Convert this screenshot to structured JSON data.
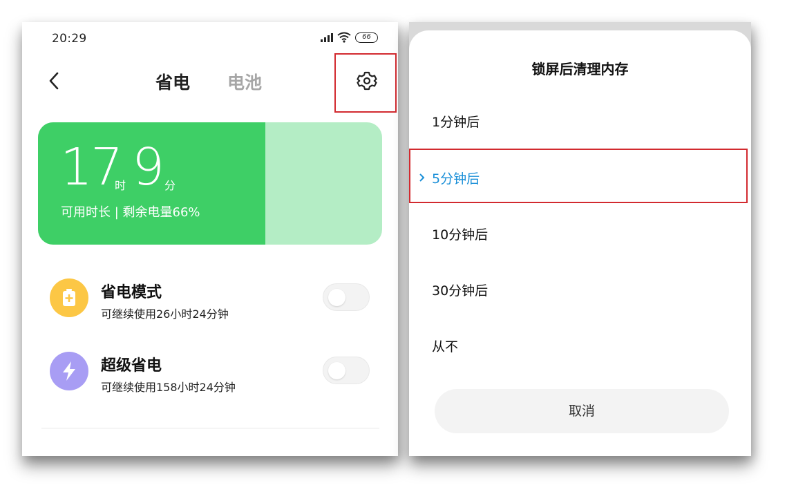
{
  "status_bar": {
    "time": "20:29",
    "battery_level": "66"
  },
  "header": {
    "tab_active": "省电",
    "tab_inactive": "电池"
  },
  "battery_card": {
    "hours": "17",
    "hours_unit": "时",
    "minutes": "9",
    "minutes_unit": "分",
    "caption": "可用时长 | 剩余电量66%",
    "level_fraction": 0.66,
    "fill_color": "#3ecf66",
    "rest_color": "#b4edc5"
  },
  "modes": [
    {
      "title": "省电模式",
      "subtitle": "可继续使用26小时24分钟",
      "icon": "battery-plus-icon",
      "color": "#fcc745",
      "enabled": false
    },
    {
      "title": "超级省电",
      "subtitle": "可继续使用158小时24分钟",
      "icon": "lightning-icon",
      "color": "#a89df4",
      "enabled": false
    }
  ],
  "dialog": {
    "title": "锁屏后清理内存",
    "options": [
      "1分钟后",
      "5分钟后",
      "10分钟后",
      "30分钟后",
      "从不"
    ],
    "selected_index": 1,
    "cancel_label": "取消"
  },
  "colors": {
    "accent_blue": "#1a8fd8",
    "highlight_red": "#d22a2f"
  }
}
